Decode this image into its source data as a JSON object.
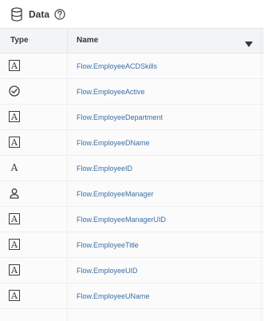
{
  "panel": {
    "title": "Data",
    "title_icon": "database-icon",
    "help_icon": "help-circle-icon"
  },
  "columns": {
    "type_label": "Type",
    "name_label": "Name",
    "sort_icon": "caret-down-icon"
  },
  "rows": [
    {
      "type_icon": "string-type-icon",
      "type_glyph": "A",
      "name": "Flow.EmployeeACDSkills"
    },
    {
      "type_icon": "boolean-type-icon",
      "type_glyph": "",
      "name": "Flow.EmployeeActive"
    },
    {
      "type_icon": "string-type-icon",
      "type_glyph": "A",
      "name": "Flow.EmployeeDepartment"
    },
    {
      "type_icon": "string-type-icon",
      "type_glyph": "A",
      "name": "Flow.EmployeeDName"
    },
    {
      "type_icon": "string-plain-type-icon",
      "type_glyph": "A",
      "name": "Flow.EmployeeID"
    },
    {
      "type_icon": "user-type-icon",
      "type_glyph": "",
      "name": "Flow.EmployeeManager"
    },
    {
      "type_icon": "string-type-icon",
      "type_glyph": "A",
      "name": "Flow.EmployeeManagerUID"
    },
    {
      "type_icon": "string-type-icon",
      "type_glyph": "A",
      "name": "Flow.EmployeeTitle"
    },
    {
      "type_icon": "string-type-icon",
      "type_glyph": "A",
      "name": "Flow.EmployeeUID"
    },
    {
      "type_icon": "string-type-icon",
      "type_glyph": "A",
      "name": "Flow.EmployeeUName"
    }
  ],
  "colors": {
    "name_link": "#3a6fa5",
    "header_bg": "#f3f4f6",
    "icon_stroke": "#3b4045"
  }
}
